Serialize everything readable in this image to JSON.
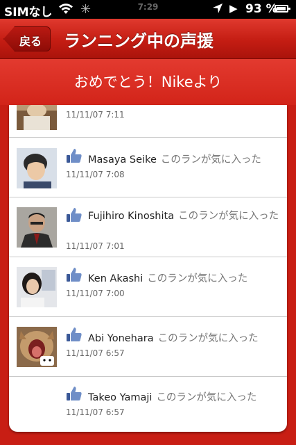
{
  "status_bar": {
    "carrier": "SIMなし",
    "time": "7:29",
    "battery_percent": "93 %",
    "battery_level": 0.93
  },
  "nav": {
    "back_label": "戻る",
    "title": "ランニング中の声援"
  },
  "banner": {
    "text": "おめでとう！Nikeより"
  },
  "cheers": [
    {
      "name": "",
      "message": "",
      "time": "11/11/07  7:11"
    },
    {
      "name": "Masaya Seike",
      "message": "このランが気に入った",
      "time": "11/11/07  7:08"
    },
    {
      "name": "Fujihiro Kinoshita",
      "message": "このランが気に入った",
      "time": "11/11/07  7:01"
    },
    {
      "name": "Ken Akashi",
      "message": "このランが気に入った",
      "time": "11/11/07  7:00"
    },
    {
      "name": "Abi Yonehara",
      "message": "このランが気に入った",
      "time": "11/11/07  6:57"
    },
    {
      "name": "Takeo Yamaji",
      "message": "このランが気に入った",
      "time": "11/11/07  6:57"
    }
  ],
  "colors": {
    "nav_red": "#c41d13",
    "banner_red": "#d22419",
    "like_blue": "#3b5998"
  }
}
